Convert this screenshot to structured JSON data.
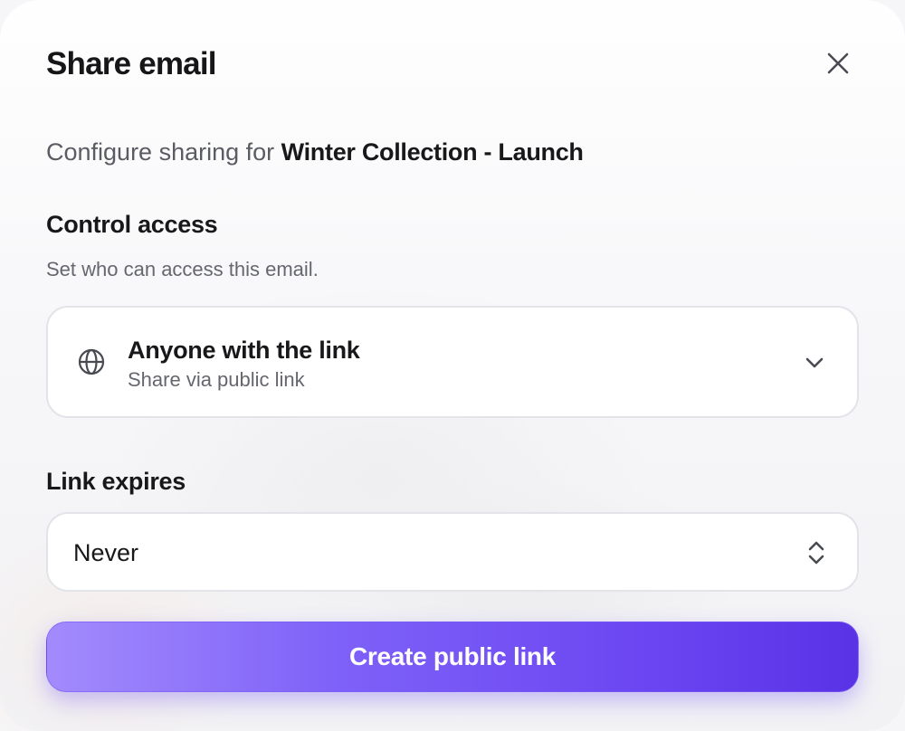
{
  "dialog": {
    "title": "Share email",
    "subtitle_prefix": "Configure sharing for",
    "subject": "Winter Collection - Launch"
  },
  "access": {
    "label": "Control access",
    "help": "Set who can access this email.",
    "selected_title": "Anyone with the link",
    "selected_subtitle": "Share via public link",
    "icon": "globe-icon"
  },
  "expiry": {
    "label": "Link expires",
    "selected": "Never"
  },
  "actions": {
    "create_label": "Create public link"
  },
  "colors": {
    "accent": "#6a45f1",
    "accent_light": "#a38bfc",
    "text_primary": "#18181b",
    "text_secondary": "#66676e"
  }
}
